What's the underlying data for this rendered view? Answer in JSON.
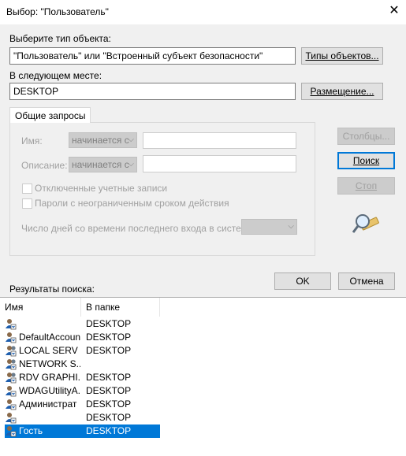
{
  "window": {
    "title": "Выбор: \"Пользователь\"",
    "close_glyph": "✕"
  },
  "object_type": {
    "label": "Выберите тип объекта:",
    "value": "\"Пользователь\" или \"Встроенный субъект безопасности\"",
    "button": "Типы объектов..."
  },
  "location": {
    "label": "В следующем месте:",
    "value": "DESKTOP",
    "button": "Размещение..."
  },
  "tab": {
    "label": "Общие запросы"
  },
  "query": {
    "name_label": "Имя:",
    "name_mode": "начинается с",
    "description_label": "Описание:",
    "description_mode": "начинается с",
    "disabled_accounts": "Отключенные учетные записи",
    "non_expiring_passwords": "Пароли с неограниченным сроком действия",
    "days_since_logon": "Число дней со времени последнего входа в систему:"
  },
  "side_buttons": {
    "columns": "Столбцы...",
    "search": "Поиск",
    "stop": "Стоп"
  },
  "ok": "OK",
  "cancel": "Отмена",
  "results": {
    "label": "Результаты поиска:",
    "col_name": "Имя",
    "col_folder": "В папке",
    "rows": [
      {
        "name": "",
        "folder": "DESKTOP",
        "icon": "user-icon"
      },
      {
        "name": "DefaultAccount",
        "folder": "DESKTOP",
        "icon": "user-icon"
      },
      {
        "name": "LOCAL SERV",
        "folder": "DESKTOP",
        "icon": "group-icon"
      },
      {
        "name": "NETWORK S...",
        "folder": "",
        "icon": "group-icon"
      },
      {
        "name": "RDV GRAPHI...",
        "folder": "DESKTOP",
        "icon": "group-icon"
      },
      {
        "name": "WDAGUtilityA...",
        "folder": "DESKTOP",
        "icon": "user-icon"
      },
      {
        "name": "Администрат",
        "folder": "DESKTOP",
        "icon": "user-icon"
      },
      {
        "name": "",
        "folder": "DESKTOP",
        "icon": "user-icon"
      },
      {
        "name": "Гость",
        "folder": "DESKTOP",
        "icon": "user-icon",
        "selected": true
      }
    ]
  },
  "colors": {
    "selection": "#0078d7",
    "background": "#f0f0f0"
  }
}
